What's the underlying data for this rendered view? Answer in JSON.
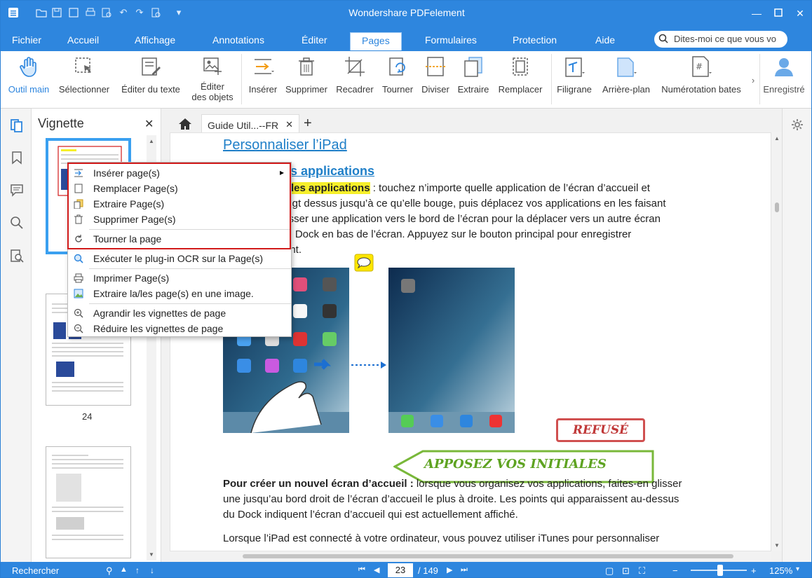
{
  "app": {
    "title": "Wondershare PDFelement"
  },
  "menu": {
    "tabs": [
      "Fichier",
      "Accueil",
      "Affichage",
      "Annotations",
      "Éditer",
      "Pages",
      "Formulaires",
      "Protection",
      "Aide"
    ],
    "active": "Pages",
    "search_placeholder": "Dites-moi ce que vous vo"
  },
  "ribbon": {
    "buttons": [
      {
        "label": "Outil main",
        "icon": "hand-icon"
      },
      {
        "label": "Sélectionner",
        "icon": "select-icon"
      },
      {
        "label": "Éditer du texte",
        "icon": "edit-text-icon"
      },
      {
        "label": "Éditer",
        "label2": "des objets",
        "icon": "edit-objects-icon"
      },
      {
        "label": "Insérer",
        "icon": "insert-icon"
      },
      {
        "label": "Supprimer",
        "icon": "delete-icon"
      },
      {
        "label": "Recadrer",
        "icon": "crop-icon"
      },
      {
        "label": "Tourner",
        "icon": "rotate-icon"
      },
      {
        "label": "Diviser",
        "icon": "split-icon"
      },
      {
        "label": "Extraire",
        "icon": "extract-icon"
      },
      {
        "label": "Remplacer",
        "icon": "replace-icon"
      },
      {
        "label": "Filigrane",
        "icon": "watermark-icon"
      },
      {
        "label": "Arrière-plan",
        "icon": "background-icon"
      },
      {
        "label": "Numérotation bates",
        "icon": "bates-icon"
      },
      {
        "label": "Enregistré",
        "icon": "user-icon"
      }
    ]
  },
  "thumbnails": {
    "header": "Vignette",
    "page_label": "24"
  },
  "document": {
    "tab_label": "Guide Util...--FR",
    "heading1": "Personnaliser l’iPad",
    "heading2": "os applications",
    "line1_hl": "r les applications",
    "line1_rest": " : touchez n’importe quelle application de l’écran d’accueil et",
    "line2": "oigt dessus jusqu’à ce qu’elle bouge, puis déplacez vos applications en les faisant",
    "line3": "lisser une application vers le bord de l’écran pour la déplacer vers un autre écran",
    "line4": "le Dock en bas de l’écran. Appuyez sur le bouton principal pour enregistrer",
    "line5": "ent.",
    "stamp_refused": "REFUSÉ",
    "stamp_initials": "APPOSEZ VOS INITIALES",
    "para2_bold": "Pour créer un nouvel écran d’accueil :",
    "para2_rest": " lorsque vous organisez vos applications, faites-en glisser",
    "para2_l2": "une jusqu’au bord droit de l’écran d’accueil le plus à droite. Les points qui apparaissent au-dessus",
    "para2_l3": "du Dock indiquent l’écran d’accueil qui est actuellement affiché.",
    "para3_l1": "Lorsque l’iPad est connecté à votre ordinateur, vous pouvez utiliser iTunes pour personnaliser"
  },
  "context_menu": {
    "items": [
      {
        "label": "Insérer page(s)",
        "icon": "insert-page-icon",
        "submenu": "▸"
      },
      {
        "label": "Remplacer Page(s)",
        "icon": "replace-page-icon"
      },
      {
        "label": "Extraire Page(s)",
        "icon": "extract-page-icon"
      },
      {
        "label": "Supprimer Page(s)",
        "icon": "delete-page-icon"
      },
      {
        "label": "Tourner la page",
        "icon": "rotate-page-icon"
      },
      {
        "label": "Exécuter le plug-in OCR sur la Page(s)",
        "icon": "ocr-icon"
      },
      {
        "label": "Imprimer Page(s)",
        "icon": "print-icon"
      },
      {
        "label": "Extraire la/les page(s) en une image.",
        "icon": "image-extract-icon"
      },
      {
        "label": "Agrandir les vignettes de page",
        "icon": "zoom-in-icon"
      },
      {
        "label": "Réduire les vignettes de page",
        "icon": "zoom-out-icon"
      }
    ]
  },
  "status": {
    "search_label": "Rechercher",
    "current_page": "23",
    "total_pages": "/ 149",
    "zoom": "125%"
  },
  "colors": {
    "accent": "#2e86de",
    "highlight": "#f6ef2a",
    "red_box": "#d11a1a"
  }
}
